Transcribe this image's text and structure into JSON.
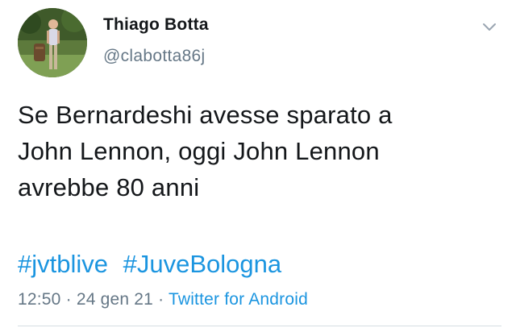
{
  "user": {
    "display_name": "Thiago Botta",
    "handle": "@clabotta86j",
    "avatar_icon": "profile-photo"
  },
  "tweet": {
    "text_lines": [
      "Se Bernardeshi avesse sparato a",
      "John Lennon, oggi John Lennon",
      "avrebbe 80 anni"
    ],
    "hashtags": [
      "#jvtblive",
      "#JuveBologna"
    ]
  },
  "meta": {
    "time": "12:50",
    "separator": " · ",
    "date": "24 gen 21",
    "source": "Twitter for Android"
  },
  "menu": {
    "icon": "chevron-down-icon"
  },
  "colors": {
    "text": "#14171a",
    "secondary": "#657786",
    "link": "#1b95e0",
    "divider": "#d6dde3"
  }
}
